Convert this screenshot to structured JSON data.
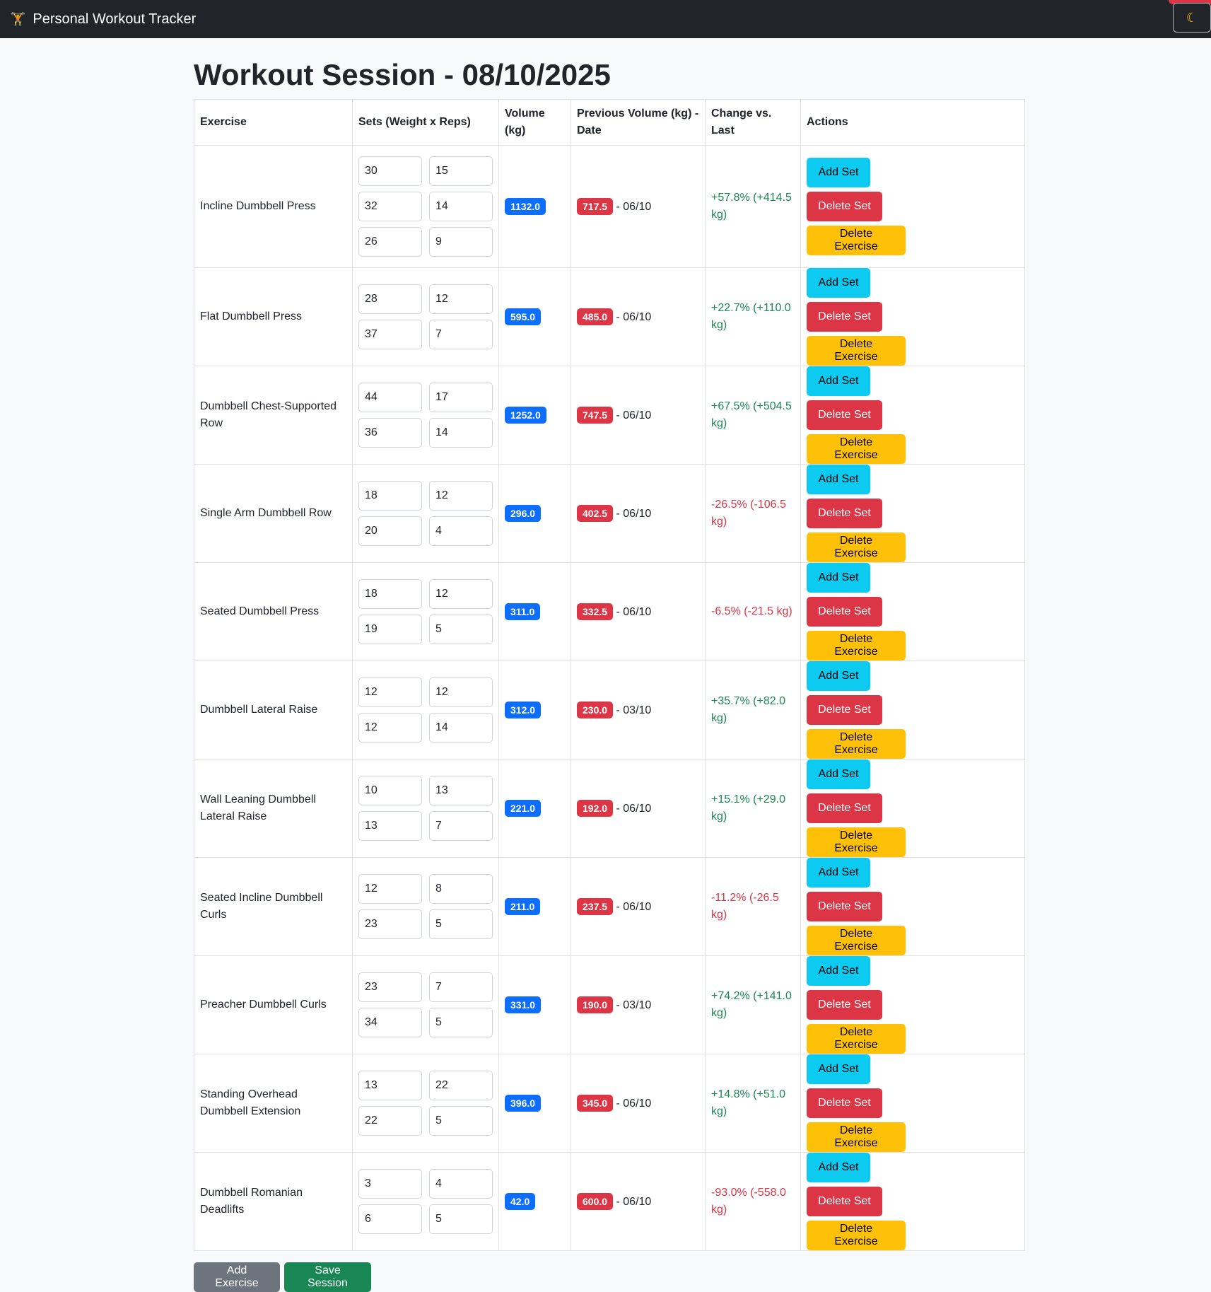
{
  "app": {
    "title": "Personal Workout Tracker",
    "theme_toggle_icon": "moon-icon"
  },
  "page": {
    "title": "Workout Session - 08/10/2025"
  },
  "table": {
    "headers": [
      "Exercise",
      "Sets (Weight x Reps)",
      "Volume (kg)",
      "Previous Volume (kg) - Date",
      "Change vs. Last",
      "Actions"
    ],
    "rows": [
      {
        "exercise": "Incline Dumbbell Press",
        "sets": [
          [
            "30",
            "15"
          ],
          [
            "32",
            "14"
          ],
          [
            "26",
            "9"
          ]
        ],
        "volume": "1132.0",
        "prev_volume": "717.5",
        "prev_date": "- 06/10",
        "change": "+57.8% (+414.5 kg)",
        "trend": "pos"
      },
      {
        "exercise": "Flat Dumbbell Press",
        "sets": [
          [
            "28",
            "12"
          ],
          [
            "37",
            "7"
          ]
        ],
        "volume": "595.0",
        "prev_volume": "485.0",
        "prev_date": "- 06/10",
        "change": "+22.7% (+110.0 kg)",
        "trend": "pos"
      },
      {
        "exercise": "Dumbbell Chest-Supported Row",
        "sets": [
          [
            "44",
            "17"
          ],
          [
            "36",
            "14"
          ]
        ],
        "volume": "1252.0",
        "prev_volume": "747.5",
        "prev_date": "- 06/10",
        "change": "+67.5% (+504.5 kg)",
        "trend": "pos"
      },
      {
        "exercise": "Single Arm Dumbbell Row",
        "sets": [
          [
            "18",
            "12"
          ],
          [
            "20",
            "4"
          ]
        ],
        "volume": "296.0",
        "prev_volume": "402.5",
        "prev_date": "- 06/10",
        "change": "-26.5% (-106.5 kg)",
        "trend": "neg"
      },
      {
        "exercise": "Seated Dumbbell Press",
        "sets": [
          [
            "18",
            "12"
          ],
          [
            "19",
            "5"
          ]
        ],
        "volume": "311.0",
        "prev_volume": "332.5",
        "prev_date": "- 06/10",
        "change": "-6.5% (-21.5 kg)",
        "trend": "neg"
      },
      {
        "exercise": "Dumbbell Lateral Raise",
        "sets": [
          [
            "12",
            "12"
          ],
          [
            "12",
            "14"
          ]
        ],
        "volume": "312.0",
        "prev_volume": "230.0",
        "prev_date": "- 03/10",
        "change": "+35.7% (+82.0 kg)",
        "trend": "pos"
      },
      {
        "exercise": "Wall Leaning Dumbbell Lateral Raise",
        "sets": [
          [
            "10",
            "13"
          ],
          [
            "13",
            "7"
          ]
        ],
        "volume": "221.0",
        "prev_volume": "192.0",
        "prev_date": "- 06/10",
        "change": "+15.1% (+29.0 kg)",
        "trend": "pos"
      },
      {
        "exercise": "Seated Incline Dumbbell Curls",
        "sets": [
          [
            "12",
            "8"
          ],
          [
            "23",
            "5"
          ]
        ],
        "volume": "211.0",
        "prev_volume": "237.5",
        "prev_date": "- 06/10",
        "change": "-11.2% (-26.5 kg)",
        "trend": "neg"
      },
      {
        "exercise": "Preacher Dumbbell Curls",
        "sets": [
          [
            "23",
            "7"
          ],
          [
            "34",
            "5"
          ]
        ],
        "volume": "331.0",
        "prev_volume": "190.0",
        "prev_date": "- 03/10",
        "change": "+74.2% (+141.0 kg)",
        "trend": "pos"
      },
      {
        "exercise": "Standing Overhead Dumbbell Extension",
        "sets": [
          [
            "13",
            "22"
          ],
          [
            "22",
            "5"
          ]
        ],
        "volume": "396.0",
        "prev_volume": "345.0",
        "prev_date": "- 06/10",
        "change": "+14.8% (+51.0 kg)",
        "trend": "pos"
      },
      {
        "exercise": "Dumbbell Romanian Deadlifts",
        "sets": [
          [
            "3",
            "4"
          ],
          [
            "6",
            "5"
          ]
        ],
        "volume": "42.0",
        "prev_volume": "600.0",
        "prev_date": "- 06/10",
        "change": "-93.0% (-558.0 kg)",
        "trend": "neg"
      }
    ]
  },
  "row_actions": {
    "add_set": "Add Set",
    "delete_set": "Delete Set",
    "delete_exercise": "Delete Exercise"
  },
  "footer_actions": {
    "add_exercise": "Add Exercise",
    "save_session": "Save Session"
  },
  "colors": {
    "positive": "#198754",
    "negative": "#dc3545",
    "volume_badge": "#0d6efd",
    "previous_badge": "#dc3545"
  }
}
